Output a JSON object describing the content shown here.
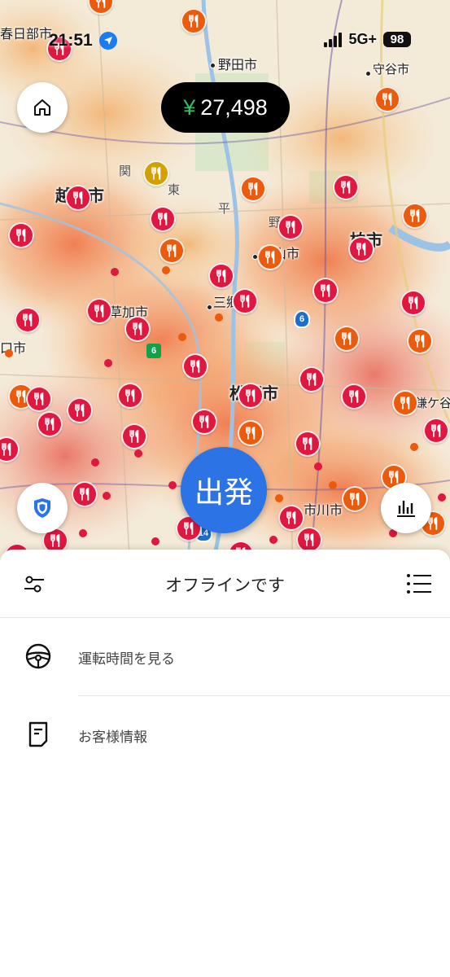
{
  "status_bar": {
    "time": "21:51",
    "network": "5G+",
    "battery": "98",
    "location_icon": "location-arrow-icon"
  },
  "map": {
    "cities": [
      {
        "name": "春日部市",
        "style": "small"
      },
      {
        "name": "野田市",
        "style": "small"
      },
      {
        "name": "守谷市",
        "style": "small"
      },
      {
        "name": "越谷市",
        "style": "big"
      },
      {
        "name": "柏市",
        "style": "big"
      },
      {
        "name": "流山市",
        "style": "small"
      },
      {
        "name": "草加市",
        "style": "small"
      },
      {
        "name": "三郷",
        "style": "small"
      },
      {
        "name": "口市",
        "style": "small"
      },
      {
        "name": "松戸市",
        "style": "big"
      },
      {
        "name": "市川市",
        "style": "small"
      },
      {
        "name": "鎌ケ谷",
        "style": "small"
      }
    ],
    "map_labels": [
      "関",
      "東",
      "平",
      "野"
    ],
    "route_numbers": [
      "6",
      "6",
      "14"
    ],
    "pin_icon": "restaurant-icon"
  },
  "controls": {
    "home_icon": "home-icon",
    "earnings_currency": "¥",
    "earnings_amount": "27,498",
    "go_label": "出発",
    "safety_icon": "shield-icon",
    "stats_icon": "bar-chart-icon"
  },
  "sheet": {
    "title": "オフラインです",
    "filter_icon": "sliders-icon",
    "list_icon": "list-icon",
    "items": [
      {
        "icon": "steering-wheel-icon",
        "label": "運転時間を見る"
      },
      {
        "icon": "document-icon",
        "label": "お客様情報"
      }
    ]
  },
  "colors": {
    "accent_blue": "#2c73e6",
    "pin_red": "#e0173f",
    "pin_orange": "#ec5a0b",
    "earnings_green": "#2bc06a"
  }
}
